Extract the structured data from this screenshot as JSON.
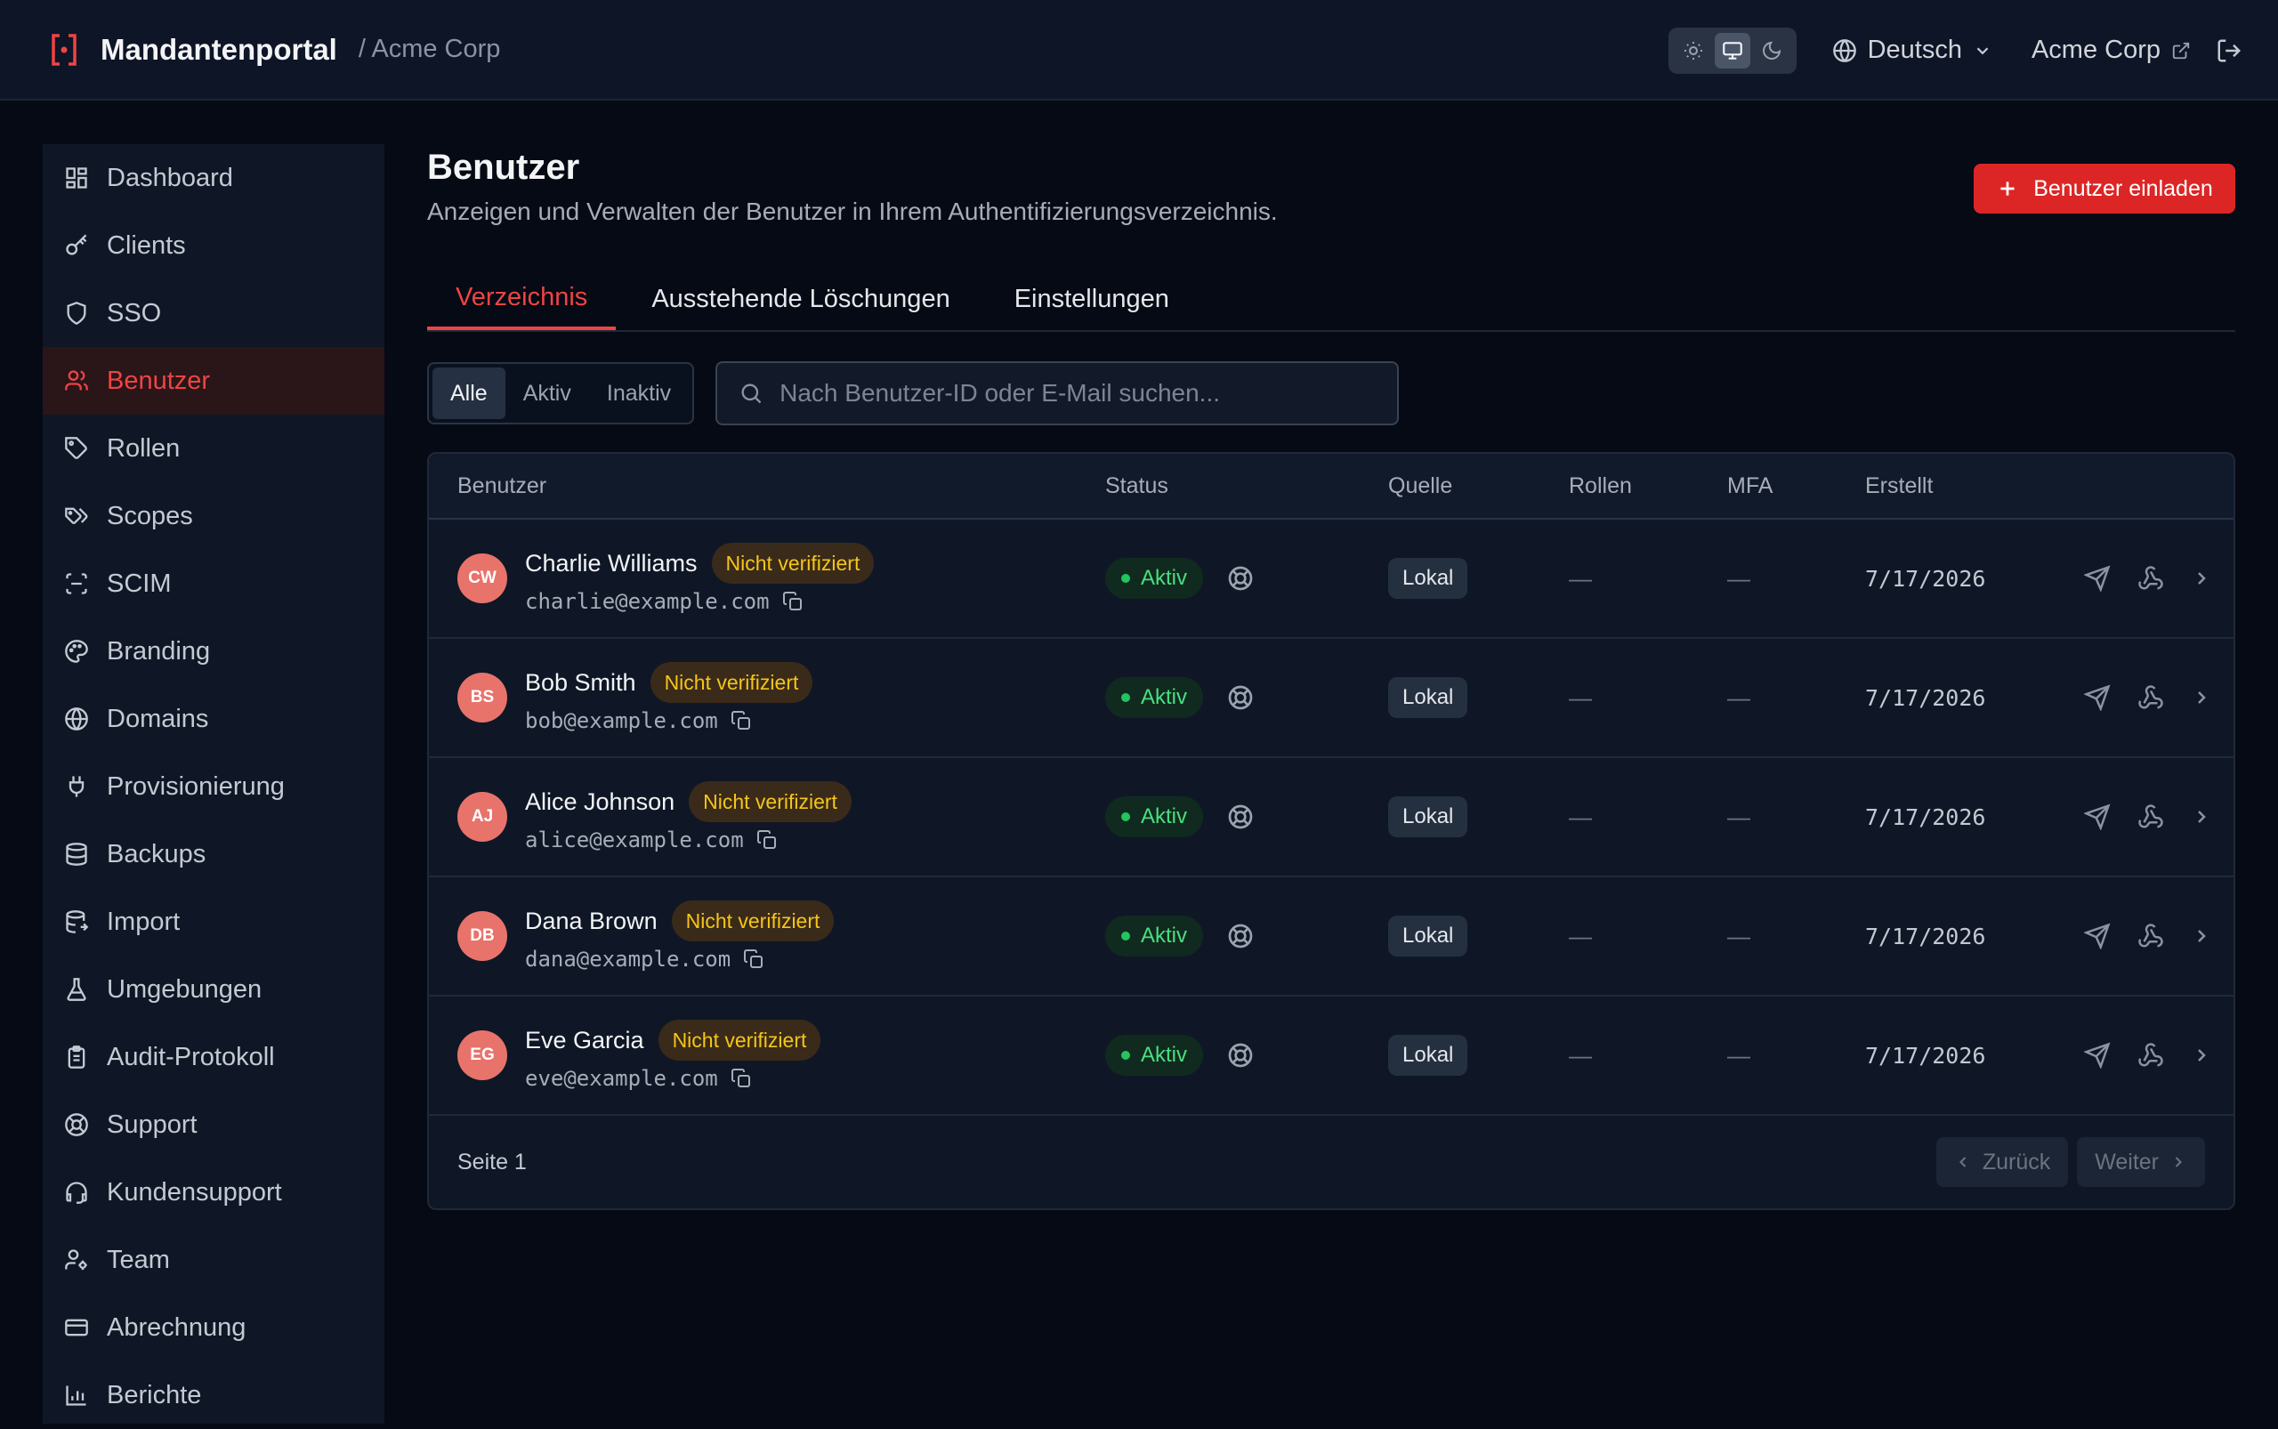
{
  "header": {
    "app_name": "Mandantenportal",
    "tenant_crumb": "/ Acme Corp",
    "theme_modes": [
      "light",
      "system",
      "dark"
    ],
    "theme_active": "system",
    "language": "Deutsch",
    "tenant_link": "Acme Corp"
  },
  "sidebar": {
    "items": [
      {
        "label": "Dashboard",
        "icon": "dashboard-icon"
      },
      {
        "label": "Clients",
        "icon": "key-icon"
      },
      {
        "label": "SSO",
        "icon": "shield-icon"
      },
      {
        "label": "Benutzer",
        "icon": "users-icon",
        "active": true
      },
      {
        "label": "Rollen",
        "icon": "tag-icon"
      },
      {
        "label": "Scopes",
        "icon": "tags-icon"
      },
      {
        "label": "SCIM",
        "icon": "scan-icon"
      },
      {
        "label": "Branding",
        "icon": "palette-icon"
      },
      {
        "label": "Domains",
        "icon": "globe-icon"
      },
      {
        "label": "Provisionierung",
        "icon": "plug-icon"
      },
      {
        "label": "Backups",
        "icon": "database-icon"
      },
      {
        "label": "Import",
        "icon": "database-import-icon"
      },
      {
        "label": "Umgebungen",
        "icon": "flask-icon"
      },
      {
        "label": "Audit-Protokoll",
        "icon": "clipboard-icon"
      },
      {
        "label": "Support",
        "icon": "lifebuoy-icon"
      },
      {
        "label": "Kundensupport",
        "icon": "headset-icon"
      },
      {
        "label": "Team",
        "icon": "user-cog-icon"
      },
      {
        "label": "Abrechnung",
        "icon": "credit-card-icon"
      },
      {
        "label": "Berichte",
        "icon": "bar-chart-icon"
      }
    ]
  },
  "page": {
    "title": "Benutzer",
    "subtitle": "Anzeigen und Verwalten der Benutzer in Ihrem Authentifizierungsverzeichnis.",
    "invite_label": "Benutzer einladen"
  },
  "tabs": [
    {
      "label": "Verzeichnis",
      "active": true
    },
    {
      "label": "Ausstehende Löschungen"
    },
    {
      "label": "Einstellungen"
    }
  ],
  "filters": {
    "options": [
      "Alle",
      "Aktiv",
      "Inaktiv"
    ],
    "selected": "Alle",
    "search_placeholder": "Nach Benutzer-ID oder E-Mail suchen..."
  },
  "table": {
    "columns": [
      "Benutzer",
      "Status",
      "Quelle",
      "Rollen",
      "MFA",
      "Erstellt"
    ],
    "rows": [
      {
        "initials": "CW",
        "name": "Charlie Williams",
        "badge": "Nicht verifiziert",
        "email": "charlie@example.com",
        "status": "Aktiv",
        "source": "Lokal",
        "roles": "—",
        "mfa": "—",
        "created": "7/17/2026"
      },
      {
        "initials": "BS",
        "name": "Bob Smith",
        "badge": "Nicht verifiziert",
        "email": "bob@example.com",
        "status": "Aktiv",
        "source": "Lokal",
        "roles": "—",
        "mfa": "—",
        "created": "7/17/2026"
      },
      {
        "initials": "AJ",
        "name": "Alice Johnson",
        "badge": "Nicht verifiziert",
        "email": "alice@example.com",
        "status": "Aktiv",
        "source": "Lokal",
        "roles": "—",
        "mfa": "—",
        "created": "7/17/2026"
      },
      {
        "initials": "DB",
        "name": "Dana Brown",
        "badge": "Nicht verifiziert",
        "email": "dana@example.com",
        "status": "Aktiv",
        "source": "Lokal",
        "roles": "—",
        "mfa": "—",
        "created": "7/17/2026"
      },
      {
        "initials": "EG",
        "name": "Eve Garcia",
        "badge": "Nicht verifiziert",
        "email": "eve@example.com",
        "status": "Aktiv",
        "source": "Lokal",
        "roles": "—",
        "mfa": "—",
        "created": "7/17/2026"
      }
    ],
    "footer": {
      "page_label": "Seite 1",
      "prev_label": "Zurück",
      "next_label": "Weiter"
    }
  },
  "colors": {
    "accent": "#dc2626",
    "active_status": "#4ade80",
    "unverified": "#f5c518",
    "background": "#050a14"
  }
}
